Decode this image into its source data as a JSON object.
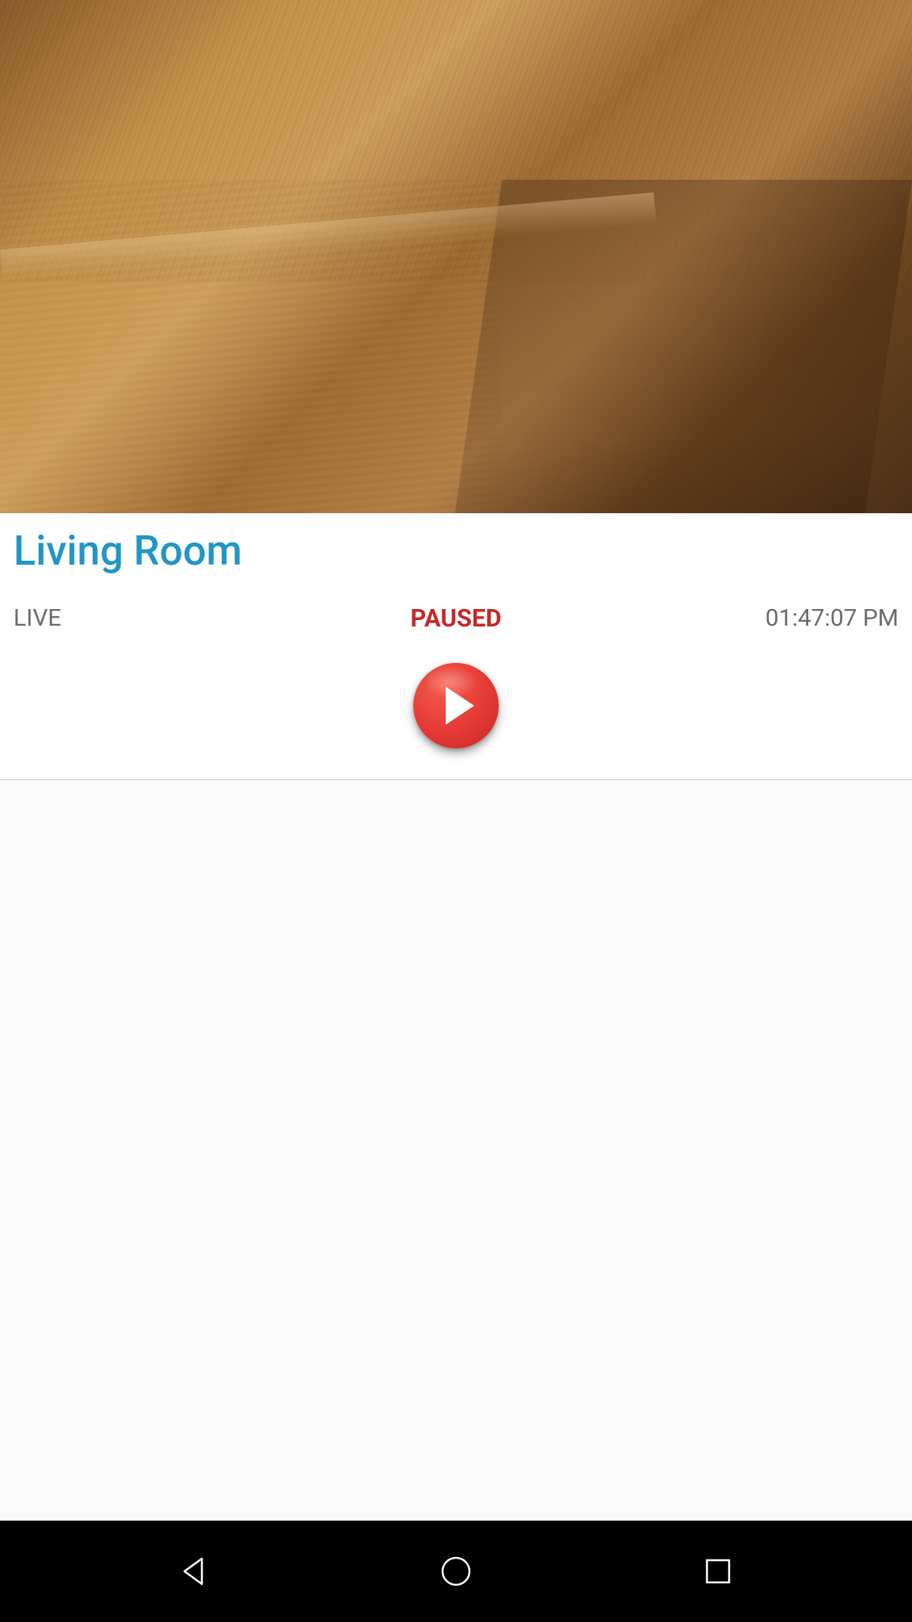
{
  "camera": {
    "title": "Living Room",
    "live_label": "LIVE",
    "status": "PAUSED",
    "timestamp": "01:47:07 PM"
  },
  "colors": {
    "title_color": "#2196c4",
    "status_color": "#c62828",
    "muted_text": "#6b6b6b",
    "play_button": "#e53935"
  }
}
